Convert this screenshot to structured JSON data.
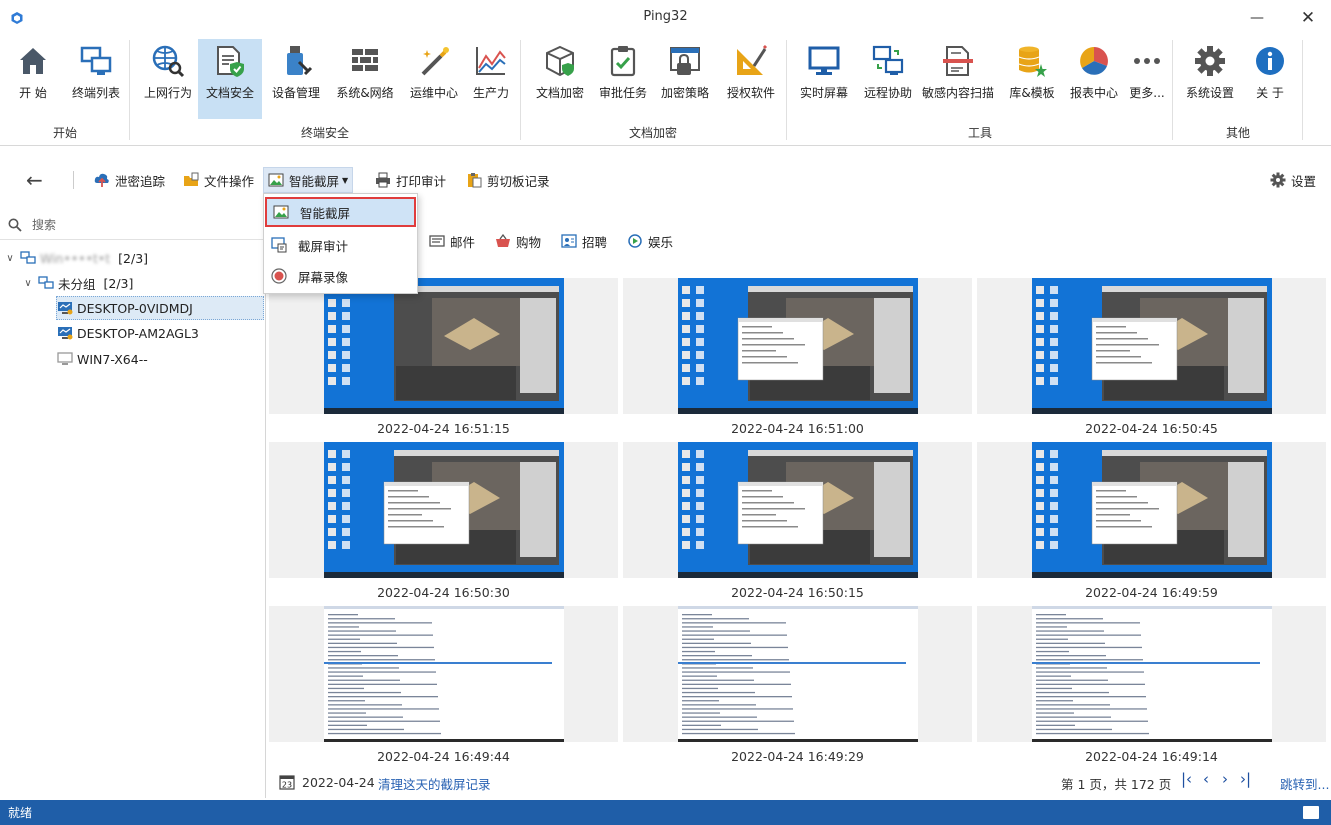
{
  "window": {
    "title": "Ping32"
  },
  "ribbon": {
    "groups": [
      {
        "label": "开始"
      },
      {
        "label": "终端安全"
      },
      {
        "label": "文档加密"
      },
      {
        "label": "工具"
      },
      {
        "label": "其他"
      }
    ],
    "buttons": [
      {
        "label": "开 始",
        "icon": "home-icon"
      },
      {
        "label": "终端列表",
        "icon": "terminal-list-icon"
      },
      {
        "label": "上网行为",
        "icon": "web-behavior-icon"
      },
      {
        "label": "文档安全",
        "icon": "document-security-icon"
      },
      {
        "label": "设备管理",
        "icon": "device-management-icon"
      },
      {
        "label": "系统&网络",
        "icon": "system-network-icon"
      },
      {
        "label": "运维中心",
        "icon": "ops-center-icon"
      },
      {
        "label": "生产力",
        "icon": "productivity-icon"
      },
      {
        "label": "文档加密",
        "icon": "document-encrypt-icon"
      },
      {
        "label": "审批任务",
        "icon": "approval-task-icon"
      },
      {
        "label": "加密策略",
        "icon": "encrypt-policy-icon"
      },
      {
        "label": "授权软件",
        "icon": "authorized-software-icon"
      },
      {
        "label": "实时屏幕",
        "icon": "realtime-screen-icon"
      },
      {
        "label": "远程协助",
        "icon": "remote-assist-icon"
      },
      {
        "label": "敏感内容扫描",
        "icon": "sensitive-scan-icon"
      },
      {
        "label": "库&模板",
        "icon": "library-template-icon"
      },
      {
        "label": "报表中心",
        "icon": "report-center-icon"
      },
      {
        "label": "更多...",
        "icon": "more-icon"
      },
      {
        "label": "系统设置",
        "icon": "settings-icon"
      },
      {
        "label": "关 于",
        "icon": "about-icon"
      }
    ]
  },
  "toolbar": {
    "items": [
      {
        "label": "泄密追踪",
        "icon": "leak-trace-icon"
      },
      {
        "label": "文件操作",
        "icon": "file-operation-icon"
      },
      {
        "label": "智能截屏",
        "icon": "smart-screenshot-icon"
      },
      {
        "label": "打印审计",
        "icon": "print-audit-icon"
      },
      {
        "label": "剪切板记录",
        "icon": "clipboard-icon"
      }
    ],
    "settings_label": "设置"
  },
  "dropdown": {
    "items": [
      {
        "label": "智能截屏",
        "icon": "smart-screenshot-icon"
      },
      {
        "label": "截屏审计",
        "icon": "screenshot-audit-icon"
      },
      {
        "label": "屏幕录像",
        "icon": "screen-record-icon"
      }
    ]
  },
  "sidebar": {
    "search_placeholder": "搜索",
    "root": {
      "name": "Win••••t•t",
      "count": "[2/3]"
    },
    "group": {
      "name": "未分组",
      "count": "[2/3]"
    },
    "devices": [
      {
        "name": "DESKTOP-0VIDMDJ",
        "online": true
      },
      {
        "name": "DESKTOP-AM2AGL3",
        "online": true
      },
      {
        "name": "WIN7-X64--",
        "online": false
      }
    ]
  },
  "categories": [
    {
      "label": "邮件",
      "icon": "mail-icon"
    },
    {
      "label": "购物",
      "icon": "shopping-icon"
    },
    {
      "label": "招聘",
      "icon": "recruit-icon"
    },
    {
      "label": "娱乐",
      "icon": "entertainment-icon"
    }
  ],
  "screenshots": [
    {
      "timestamp": "2022-04-24 16:51:15",
      "kind": "editor"
    },
    {
      "timestamp": "2022-04-24 16:51:00",
      "kind": "editor-dialog"
    },
    {
      "timestamp": "2022-04-24 16:50:45",
      "kind": "editor-dialog"
    },
    {
      "timestamp": "2022-04-24 16:50:30",
      "kind": "editor-dialog"
    },
    {
      "timestamp": "2022-04-24 16:50:15",
      "kind": "editor-dialog"
    },
    {
      "timestamp": "2022-04-24 16:49:59",
      "kind": "editor-dialog"
    },
    {
      "timestamp": "2022-04-24 16:49:44",
      "kind": "log"
    },
    {
      "timestamp": "2022-04-24 16:49:29",
      "kind": "log"
    },
    {
      "timestamp": "2022-04-24 16:49:14",
      "kind": "log"
    }
  ],
  "footer": {
    "date": "2022-04-24",
    "clear_link": "清理这天的截屏记录",
    "page_info": "第 1 页，共 172 页",
    "first": "|‹",
    "prev": "‹",
    "next": "›",
    "last": "›|",
    "jump": "跳转到..."
  },
  "status": {
    "text": "就绪"
  },
  "colors": {
    "accent": "#1f5ea8",
    "selection": "#c8e0f4",
    "highlight_border": "#e03c3c",
    "link": "#2a63b3"
  }
}
